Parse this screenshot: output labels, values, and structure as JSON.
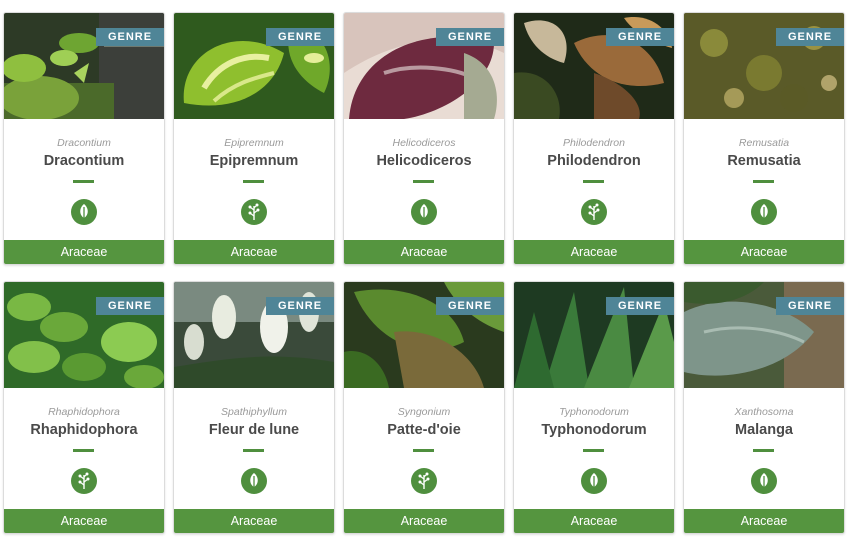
{
  "cards": [
    {
      "badge": "GENRE",
      "latin": "Dracontium",
      "name": "Dracontium",
      "icon": "leaf-icon",
      "family": "Araceae"
    },
    {
      "badge": "GENRE",
      "latin": "Epipremnum",
      "name": "Epipremnum",
      "icon": "sprig-icon",
      "family": "Araceae"
    },
    {
      "badge": "GENRE",
      "latin": "Helicodiceros",
      "name": "Helicodiceros",
      "icon": "leaf-icon",
      "family": "Araceae"
    },
    {
      "badge": "GENRE",
      "latin": "Philodendron",
      "name": "Philodendron",
      "icon": "sprig-icon",
      "family": "Araceae"
    },
    {
      "badge": "GENRE",
      "latin": "Remusatia",
      "name": "Remusatia",
      "icon": "leaf-icon",
      "family": "Araceae"
    },
    {
      "badge": "GENRE",
      "latin": "Rhaphidophora",
      "name": "Rhaphidophora",
      "icon": "sprig-icon",
      "family": "Araceae"
    },
    {
      "badge": "GENRE",
      "latin": "Spathiphyllum",
      "name": "Fleur de lune",
      "icon": "leaf-icon",
      "family": "Araceae"
    },
    {
      "badge": "GENRE",
      "latin": "Syngonium",
      "name": "Patte-d'oie",
      "icon": "sprig-icon",
      "family": "Araceae"
    },
    {
      "badge": "GENRE",
      "latin": "Typhonodorum",
      "name": "Typhonodorum",
      "icon": "leaf-icon",
      "family": "Araceae"
    },
    {
      "badge": "GENRE",
      "latin": "Xanthosoma",
      "name": "Malanga",
      "icon": "leaf-icon",
      "family": "Araceae"
    }
  ],
  "colors": {
    "badge": "#4f8597",
    "accent": "#4f8f3e",
    "footer": "#55953f"
  }
}
